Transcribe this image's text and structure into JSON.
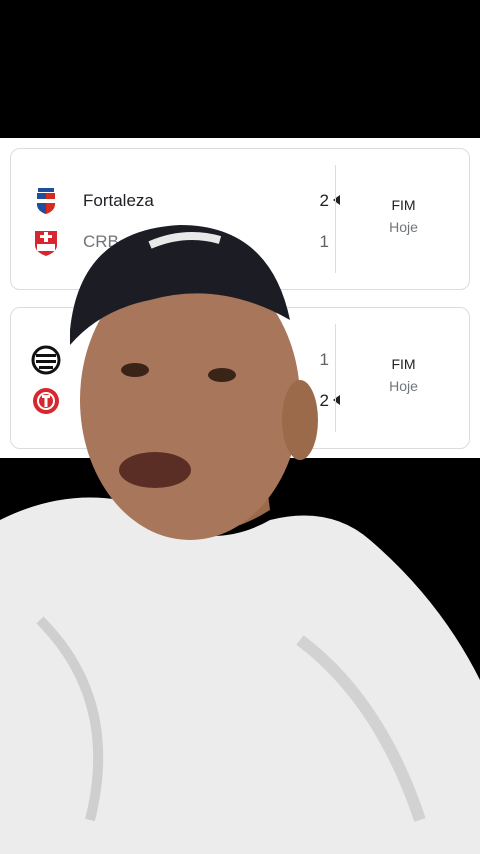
{
  "matches": [
    {
      "home": {
        "name": "Fortaleza",
        "score": "2",
        "crest_icon": "fortaleza-crest-icon"
      },
      "away": {
        "name": "CRB",
        "score": "1",
        "crest_icon": "crb-crest-icon"
      },
      "status": "FIM",
      "date": "Hoje"
    },
    {
      "home": {
        "name": "",
        "score": "1",
        "crest_icon": "striped-crest-icon"
      },
      "away": {
        "name": "",
        "score": "2",
        "crest_icon": "internacional-crest-icon"
      },
      "status": "FIM",
      "date": "Hoje"
    }
  ],
  "colors": {
    "background": "#000000",
    "card": "#ffffff",
    "border": "#dadce0",
    "text": "#202124",
    "muted": "#70757a"
  }
}
